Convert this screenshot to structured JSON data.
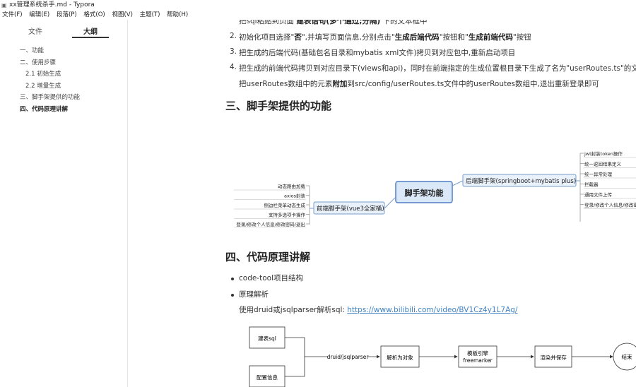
{
  "window": {
    "title": "xx管理系统杀手.md - Typora"
  },
  "menu": [
    "文件(F)",
    "编辑(E)",
    "段落(P)",
    "格式(O)",
    "视图(V)",
    "主题(T)",
    "帮助(H)"
  ],
  "sidebar": {
    "tabs": [
      {
        "label": "文件"
      },
      {
        "label": "大纲"
      }
    ],
    "outline": [
      {
        "label": "一、功能"
      },
      {
        "label": "二、使用步骤"
      },
      {
        "label": "2.1 初始生成"
      },
      {
        "label": "2.2 增量生成"
      },
      {
        "label": "三、脚手架提供的功能"
      },
      {
        "label": "四、代码原理讲解"
      }
    ]
  },
  "doc": {
    "top_line": {
      "pre": "把sql粘贴到页面 ",
      "bold": "建表语句(多个通过;分隔)",
      "post": " 下的文本框中"
    },
    "steps": [
      {
        "num": "2.",
        "parts": [
          {
            "t": "初始化项目选择\""
          },
          {
            "b": "否"
          },
          {
            "t": "\",并填写页面信息,分别点击\""
          },
          {
            "b": "生成后端代码"
          },
          {
            "t": "\"按钮和\""
          },
          {
            "b": "生成前端代码"
          },
          {
            "t": "\"按钮"
          }
        ]
      },
      {
        "num": "3.",
        "parts": [
          {
            "t": "把生成的后端代码(基础包名目录和mybatis xml文件)拷贝到对应包中,重新启动项目"
          }
        ]
      },
      {
        "num": "4.",
        "parts": [
          {
            "t": "把生成的前端代码拷贝到对应目录下(views和api)，同时在前端指定的生成位置根目录下生成了名为\"userRoutes.ts\"的文"
          }
        ]
      }
    ],
    "step4_cont": {
      "pre": "把userRoutes数组中的元素",
      "bold": "附加",
      "post": "到src/config/userRoutes.ts文件中的userRoutes数组中,退出重新登录即可"
    },
    "h3": "三、脚手架提供的功能",
    "mindmap": {
      "center": "脚手架功能",
      "frontend": {
        "label": "前端脚手架(vue3全家桶)",
        "items": [
          "动态路由加载",
          "axios封装",
          "侧边栏菜单动态生成",
          "支持多选项卡操作",
          "登录/修改个人信息/修改密码/退出"
        ]
      },
      "backend": {
        "label": "后端脚手架(springboot+mybatis plus)",
        "items": [
          "jwt封装token操作",
          "统一返回结果定义",
          "统一异常处理",
          "拦截器",
          "通用文件上传",
          "登录/修改个人信息/修改密"
        ]
      }
    },
    "h4": "四、代码原理讲解",
    "bullets": [
      "code-tool项目结构",
      "原理解析"
    ],
    "parse_line": {
      "pre": "使用druid或jsqlparser解析sql: ",
      "link": "https://www.bilibili.com/video/BV1Cz4y1L7Ag/"
    },
    "flow": {
      "n1": "建表sql",
      "n2": "配置信息",
      "edge": "druid/jsqlparser",
      "n3": "解析为对象",
      "n4a": "模板引擎",
      "n4b": "freemarker",
      "n5": "渲染并保存",
      "n6": "结束"
    }
  }
}
